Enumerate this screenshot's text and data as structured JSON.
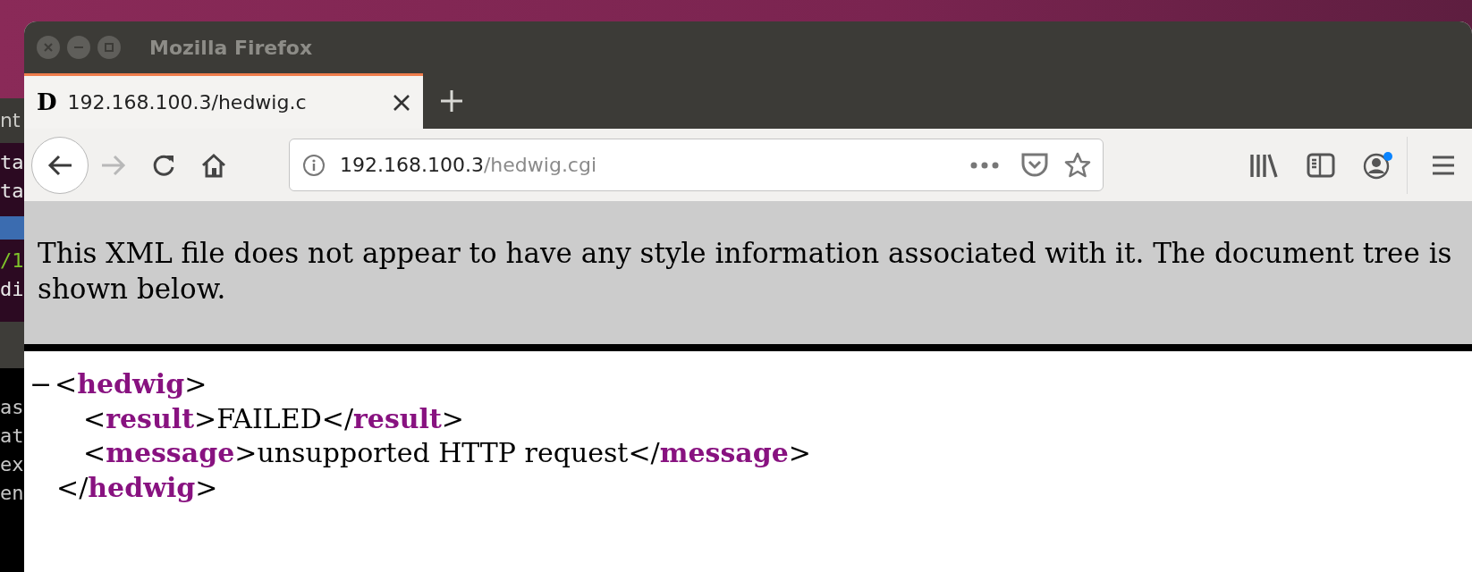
{
  "background_windows": [
    {
      "kind": "terminal",
      "title": "nt",
      "lines": [
        {
          "kind": "plain",
          "text": "ta"
        },
        {
          "kind": "plain",
          "text": "ta"
        },
        {
          "kind": "selected"
        },
        {
          "kind": "path",
          "text": "/1"
        },
        {
          "kind": "plain",
          "text": "di"
        }
      ]
    },
    {
      "kind": "terminal-dark",
      "lines": [
        {
          "kind": "plain",
          "text": "as"
        },
        {
          "kind": "plain",
          "text": "at"
        },
        {
          "kind": "plain",
          "text": "ex"
        },
        {
          "kind": "plain",
          "text": "en"
        }
      ]
    }
  ],
  "window": {
    "title": "Mozilla Firefox"
  },
  "tabs": [
    {
      "favicon": "D",
      "label": "192.168.100.3/hedwig.c",
      "selected": true
    }
  ],
  "address_bar": {
    "host": "192.168.100.3",
    "path": "/hedwig.cgi"
  },
  "toolbar": {
    "back_enabled": true,
    "forward_enabled": false,
    "account_notification": true
  },
  "info_banner": "This XML file does not appear to have any style information associated with it. The document tree is shown below.",
  "xml_tree": [
    {
      "toggle": "−",
      "expanded": true,
      "open": [
        {
          "kind": "punct",
          "text": "<"
        },
        {
          "kind": "tag",
          "text": "hedwig"
        },
        {
          "kind": "punct",
          "text": ">"
        }
      ],
      "children": [
        {
          "line": [
            {
              "kind": "punct",
              "text": "<"
            },
            {
              "kind": "tag",
              "text": "result"
            },
            {
              "kind": "punct",
              "text": ">"
            },
            {
              "kind": "text",
              "text": "FAILED"
            },
            {
              "kind": "punct",
              "text": "</"
            },
            {
              "kind": "tag",
              "text": "result"
            },
            {
              "kind": "punct",
              "text": ">"
            }
          ]
        },
        {
          "line": [
            {
              "kind": "punct",
              "text": "<"
            },
            {
              "kind": "tag",
              "text": "message"
            },
            {
              "kind": "punct",
              "text": ">"
            },
            {
              "kind": "text",
              "text": "unsupported HTTP request"
            },
            {
              "kind": "punct",
              "text": "</"
            },
            {
              "kind": "tag",
              "text": "message"
            },
            {
              "kind": "punct",
              "text": ">"
            }
          ]
        }
      ],
      "close": [
        {
          "kind": "punct",
          "text": "</"
        },
        {
          "kind": "tag",
          "text": "hedwig"
        },
        {
          "kind": "punct",
          "text": ">"
        }
      ]
    }
  ]
}
